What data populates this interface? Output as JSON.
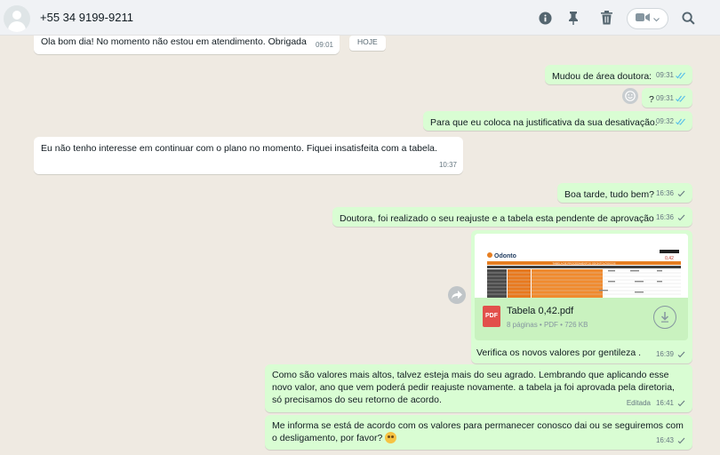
{
  "header": {
    "contact_name": "+55 34 9199-9211",
    "icons": [
      "info-icon",
      "pin-icon",
      "delete-icon",
      "video-call-icon",
      "search-icon"
    ]
  },
  "date_chip": "HOJE",
  "messages": [
    {
      "id": "m0",
      "dir": "in",
      "text": "Ola bom dia! No momento não estou em atendimento. Obrigada",
      "time": "09:01"
    },
    {
      "id": "m1",
      "dir": "out",
      "text": "Mudou de área doutora:",
      "time": "09:31",
      "status": "read"
    },
    {
      "id": "m2",
      "dir": "out",
      "text": "?",
      "time": "09:31",
      "status": "read"
    },
    {
      "id": "m3",
      "dir": "out",
      "text": "Para que eu coloca na justificativa da sua desativação.",
      "time": "09:32",
      "status": "read"
    },
    {
      "id": "m4",
      "dir": "in",
      "text": "Eu não tenho interesse em continuar com o plano no momento. Fiquei insatisfeita com a tabela.",
      "time": "10:37"
    },
    {
      "id": "m5",
      "dir": "out",
      "text": "Boa tarde, tudo bem?",
      "time": "16:36",
      "status": "sent"
    },
    {
      "id": "m6",
      "dir": "out",
      "text": "Doutora, foi realizado o seu reajuste e a tabela esta pendente de aprovação",
      "time": "16:36",
      "status": "sent"
    },
    {
      "id": "m7",
      "dir": "out",
      "type": "document",
      "file_name": "Tabela 0,42.pdf",
      "file_info": "8 páginas • PDF • 726 KB",
      "file_badge": "PDF",
      "caption": "Verifica os novos valores por gentileza .",
      "time": "16:39",
      "status": "sent",
      "thumb": {
        "brand": "Odonto",
        "badge": "0,42",
        "heading": "TABELA DE PROCEDIMENTOS ODONTOLÓGICOS"
      }
    },
    {
      "id": "m8",
      "dir": "out",
      "text": "Como são valores mais altos, talvez esteja mais do seu agrado. Lembrando que aplicando esse novo valor, ano que vem poderá pedir reajuste novamente. a tabela ja foi aprovada pela diretoria, só precisamos do seu retorno de acordo.",
      "edited_label": "Editada",
      "time": "16:41",
      "status": "sent"
    },
    {
      "id": "m9",
      "dir": "out",
      "text": "Me informa se está de acordo com os valores para permanecer conosco dai ou se seguiremos com o desligamento, por favor?",
      "emoji": "pleading-face",
      "time": "16:43",
      "status": "sent"
    }
  ],
  "colors": {
    "outgoing_bubble": "#d9fdd3",
    "incoming_bubble": "#ffffff",
    "read_tick": "#53bdeb",
    "background": "#efeae2"
  }
}
